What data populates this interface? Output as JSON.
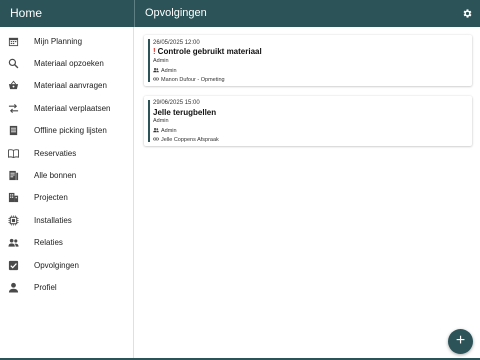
{
  "header": {
    "home_title": "Home",
    "page_title": "Opvolgingen",
    "settings_icon": "gear-icon",
    "background_color": "#2b5358"
  },
  "sidebar": {
    "items": [
      {
        "label": "Mijn Planning",
        "icon": "calendar-icon"
      },
      {
        "label": "Materiaal opzoeken",
        "icon": "search-icon"
      },
      {
        "label": "Materiaal aanvragen",
        "icon": "basket-icon"
      },
      {
        "label": "Materiaal verplaatsen",
        "icon": "swap-arrows-icon"
      },
      {
        "label": "Offline picking lijsten",
        "icon": "list-document-icon"
      },
      {
        "label": "Reservaties",
        "icon": "book-icon"
      },
      {
        "label": "Alle bonnen",
        "icon": "receipt-icon"
      },
      {
        "label": "Projecten",
        "icon": "building-icon"
      },
      {
        "label": "Installaties",
        "icon": "chip-icon"
      },
      {
        "label": "Relaties",
        "icon": "people-icon"
      },
      {
        "label": "Opvolgingen",
        "icon": "checkbox-icon"
      },
      {
        "label": "Profiel",
        "icon": "person-icon"
      }
    ]
  },
  "followups": [
    {
      "date": "26/05/2025 12:00",
      "priority": true,
      "title": "Controle gebruikt materiaal",
      "creator": "Admin",
      "assignee": "Admin",
      "link": "Manon Dufour - Opmeting"
    },
    {
      "date": "29/06/2025 15:00",
      "priority": false,
      "title": "Jelle terugbellen",
      "creator": "Admin",
      "assignee": "Admin",
      "link": "Jelle Coppens Afspraak"
    }
  ],
  "fab": {
    "label": "+",
    "icon": "plus-icon"
  },
  "colors": {
    "accent": "#2b5358",
    "priority": "#d9342b"
  }
}
